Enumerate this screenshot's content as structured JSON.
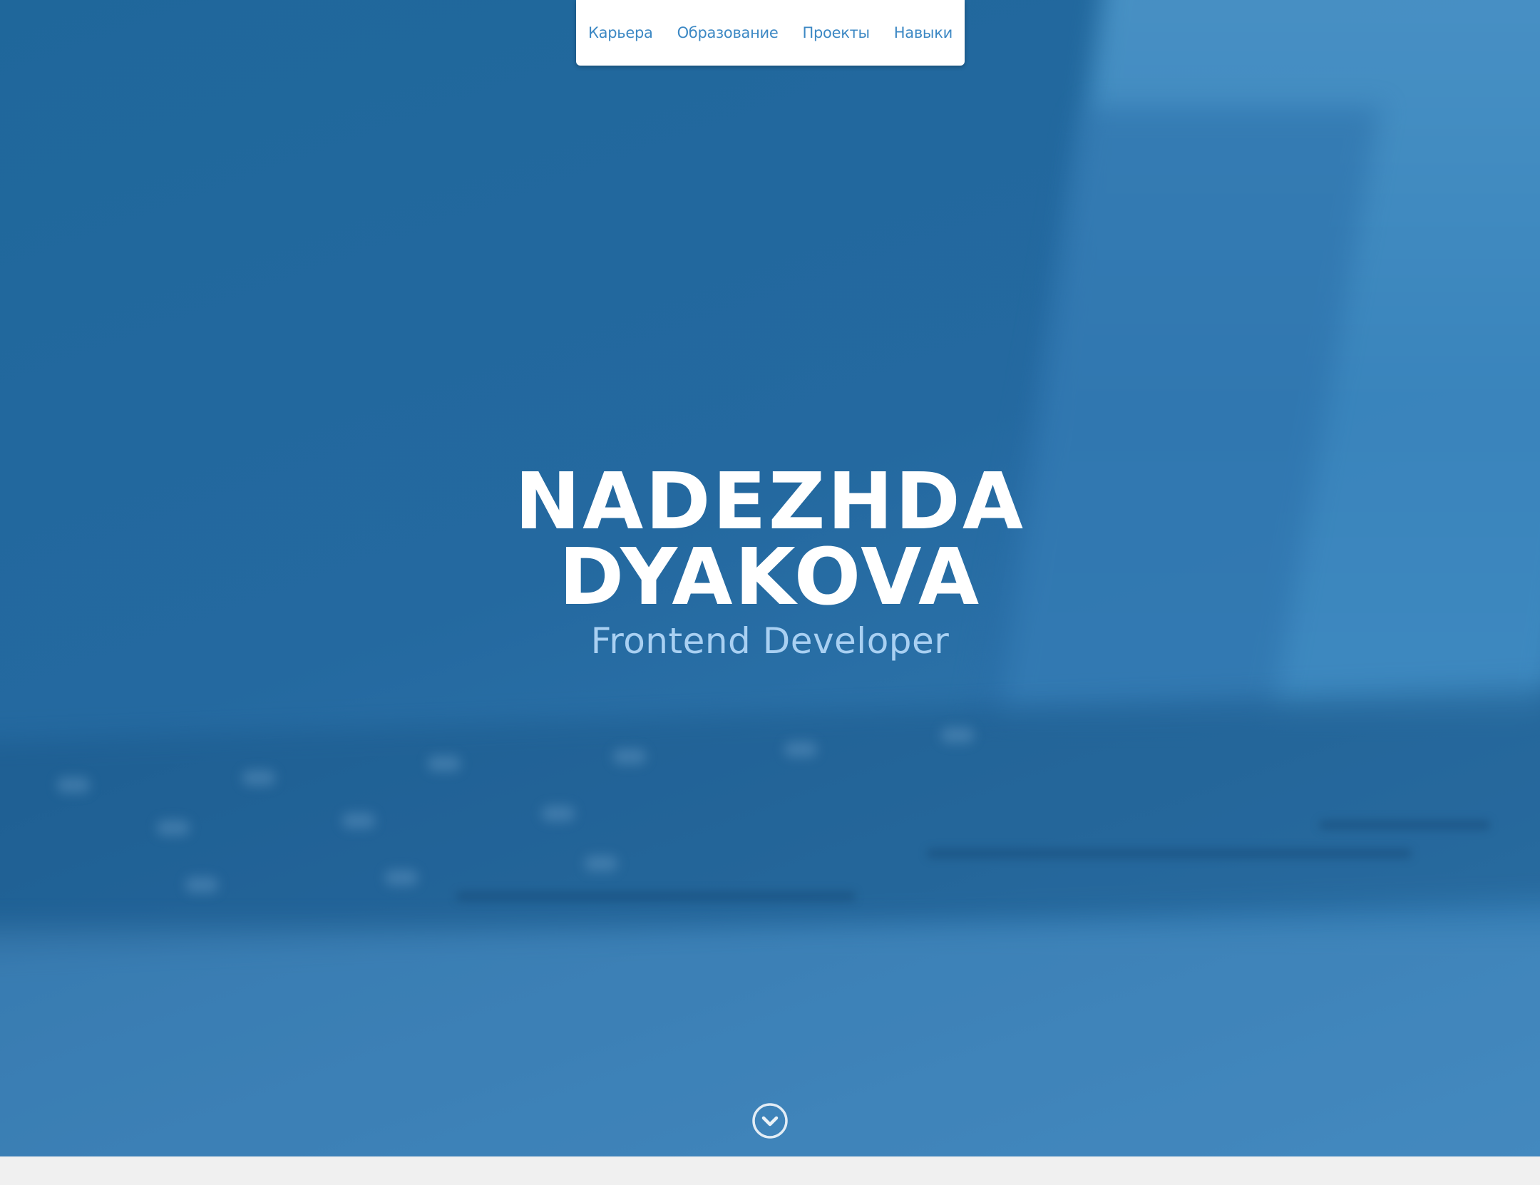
{
  "nav": {
    "items": [
      {
        "label": "Карьера"
      },
      {
        "label": "Образование"
      },
      {
        "label": "Проекты"
      },
      {
        "label": "Навыки"
      }
    ]
  },
  "hero": {
    "name_first": "NADEZHDA",
    "name_last": "DYAKOVA",
    "subtitle": "Frontend Developer",
    "scroll_icon": "chevron-down-circle-icon"
  },
  "colors": {
    "hero_background": "#2369a0",
    "nav_link": "#3c88c4",
    "title": "#ffffff",
    "subtitle": "#a9d0f2"
  }
}
